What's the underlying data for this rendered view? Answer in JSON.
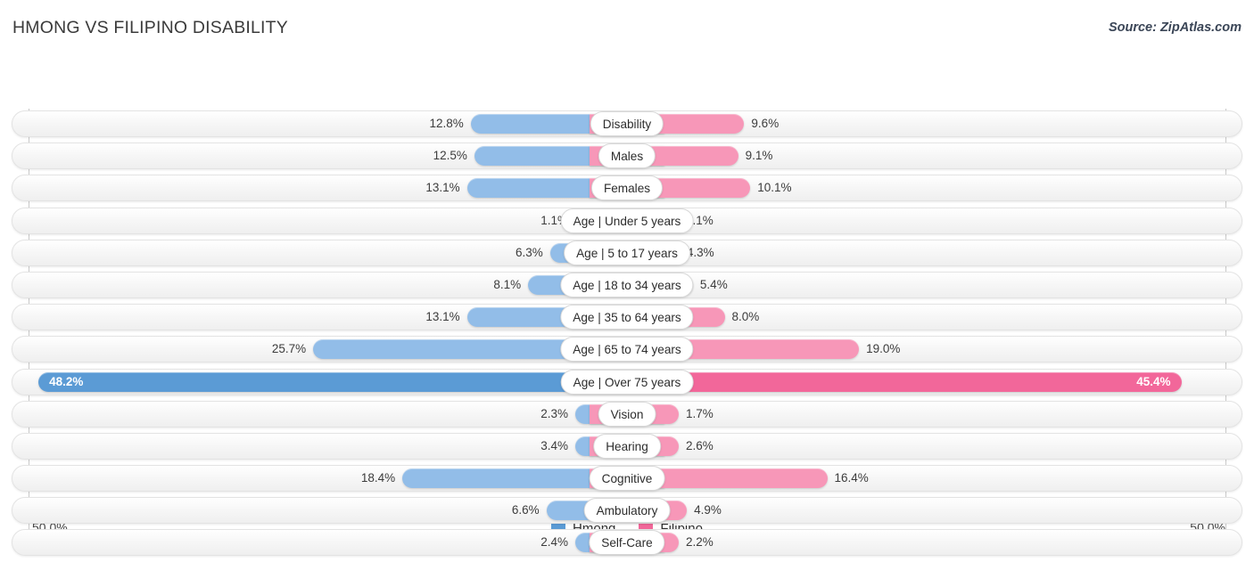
{
  "header": {
    "title": "HMONG VS FILIPINO DISABILITY",
    "source": "Source: ZipAtlas.com"
  },
  "axis": {
    "left_max": "50.0%",
    "right_max": "50.0%"
  },
  "legend": [
    {
      "label": "Hmong",
      "color": "#5b9bd5"
    },
    {
      "label": "Filipino",
      "color": "#f2679a"
    }
  ],
  "chart_data": {
    "type": "bar",
    "title": "Hmong vs Filipino Disability",
    "orientation": "horizontal-diverging",
    "xlabel": "",
    "ylabel": "",
    "xlim": [
      -50.0,
      50.0
    ],
    "grid": true,
    "legend_position": "bottom-center",
    "categories": [
      "Disability",
      "Males",
      "Females",
      "Age | Under 5 years",
      "Age | 5 to 17 years",
      "Age | 18 to 34 years",
      "Age | 35 to 64 years",
      "Age | 65 to 74 years",
      "Age | Over 75 years",
      "Vision",
      "Hearing",
      "Cognitive",
      "Ambulatory",
      "Self-Care"
    ],
    "series": [
      {
        "name": "Hmong",
        "color": "#92bde8",
        "highlight_color": "#5b9bd5",
        "values": [
          12.8,
          12.5,
          13.1,
          1.1,
          6.3,
          8.1,
          13.1,
          25.7,
          48.2,
          2.3,
          3.4,
          18.4,
          6.6,
          2.4
        ]
      },
      {
        "name": "Filipino",
        "color": "#f797b8",
        "highlight_color": "#f2679a",
        "values": [
          9.6,
          9.1,
          10.1,
          1.1,
          4.3,
          5.4,
          8.0,
          19.0,
          45.4,
          1.7,
          2.6,
          16.4,
          4.9,
          2.2
        ]
      }
    ]
  },
  "rows": [
    {
      "label": "Disability",
      "left_value": "12.8%",
      "right_value": "9.6%",
      "left_pct": 12.8,
      "right_pct": 9.6,
      "highlight": false
    },
    {
      "label": "Males",
      "left_value": "12.5%",
      "right_value": "9.1%",
      "left_pct": 12.5,
      "right_pct": 9.1,
      "highlight": false
    },
    {
      "label": "Females",
      "left_value": "13.1%",
      "right_value": "10.1%",
      "left_pct": 13.1,
      "right_pct": 10.1,
      "highlight": false
    },
    {
      "label": "Age | Under 5 years",
      "left_value": "1.1%",
      "right_value": "1.1%",
      "left_pct": 1.1,
      "right_pct": 1.1,
      "highlight": false
    },
    {
      "label": "Age | 5 to 17 years",
      "left_value": "6.3%",
      "right_value": "4.3%",
      "left_pct": 6.3,
      "right_pct": 4.3,
      "highlight": false
    },
    {
      "label": "Age | 18 to 34 years",
      "left_value": "8.1%",
      "right_value": "5.4%",
      "left_pct": 8.1,
      "right_pct": 5.4,
      "highlight": false
    },
    {
      "label": "Age | 35 to 64 years",
      "left_value": "13.1%",
      "right_value": "8.0%",
      "left_pct": 13.1,
      "right_pct": 8.0,
      "highlight": false
    },
    {
      "label": "Age | 65 to 74 years",
      "left_value": "25.7%",
      "right_value": "19.0%",
      "left_pct": 25.7,
      "right_pct": 19.0,
      "highlight": false
    },
    {
      "label": "Age | Over 75 years",
      "left_value": "48.2%",
      "right_value": "45.4%",
      "left_pct": 48.2,
      "right_pct": 45.4,
      "highlight": true
    },
    {
      "label": "Vision",
      "left_value": "2.3%",
      "right_value": "1.7%",
      "left_pct": 2.3,
      "right_pct": 1.7,
      "highlight": false
    },
    {
      "label": "Hearing",
      "left_value": "3.4%",
      "right_value": "2.6%",
      "left_pct": 3.4,
      "right_pct": 2.6,
      "highlight": false
    },
    {
      "label": "Cognitive",
      "left_value": "18.4%",
      "right_value": "16.4%",
      "left_pct": 18.4,
      "right_pct": 16.4,
      "highlight": false
    },
    {
      "label": "Ambulatory",
      "left_value": "6.6%",
      "right_value": "4.9%",
      "left_pct": 6.6,
      "right_pct": 4.9,
      "highlight": false
    },
    {
      "label": "Self-Care",
      "left_value": "2.4%",
      "right_value": "2.2%",
      "left_pct": 2.4,
      "right_pct": 2.2,
      "highlight": false
    }
  ]
}
